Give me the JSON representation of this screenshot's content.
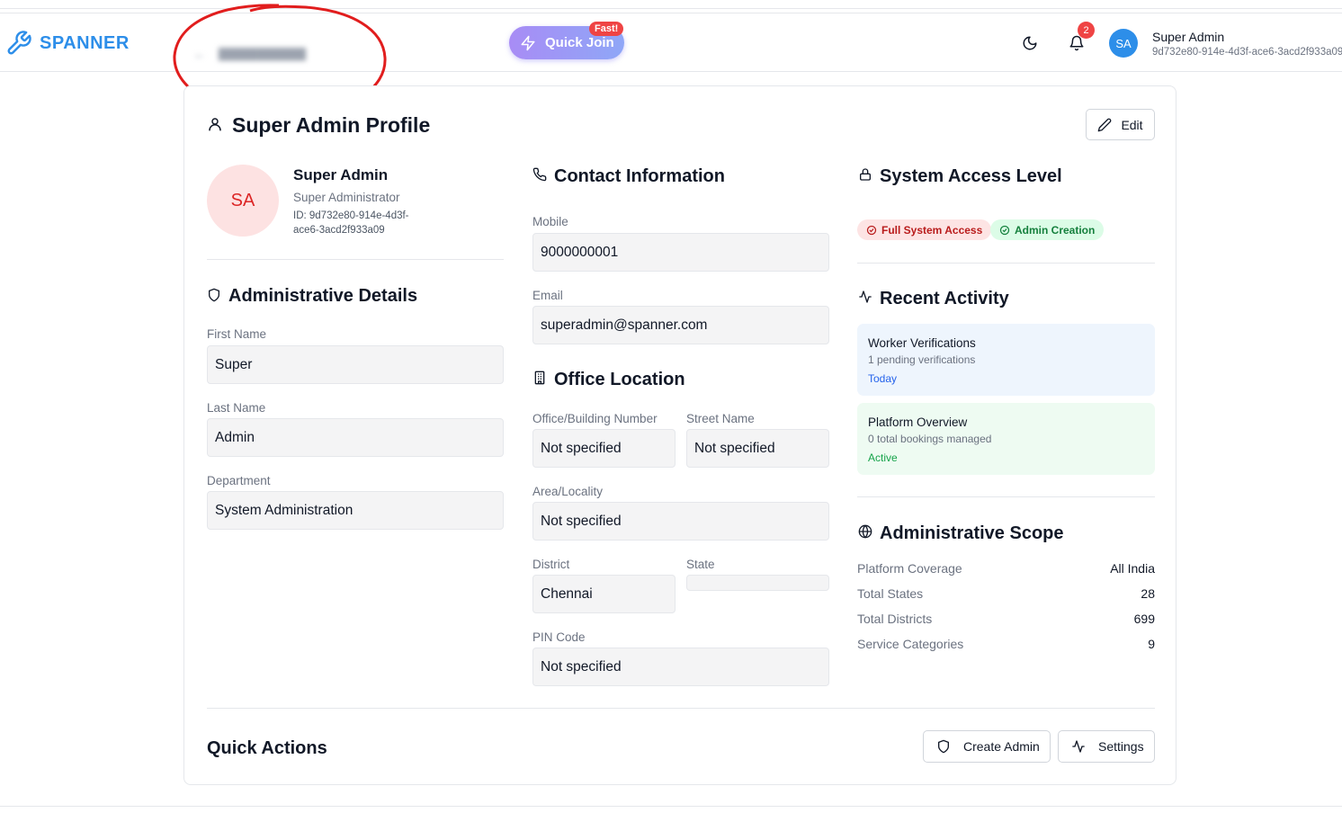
{
  "header": {
    "brand": "SPANNER",
    "quick_join": "Quick Join",
    "fast_badge": "Fast!",
    "notification_count": "2",
    "avatar_initials": "SA",
    "user_name": "Super Admin",
    "user_id": "9d732e80-914e-4d3f-ace6-3acd2f933a09"
  },
  "profile": {
    "title": "Super Admin Profile",
    "edit_label": "Edit",
    "avatar_initials": "SA",
    "name": "Super Admin",
    "role": "Super Administrator",
    "id_line1": "ID: 9d732e80-914e-4d3f-",
    "id_line2": "ace6-3acd2f933a09"
  },
  "admin_details": {
    "title": "Administrative Details",
    "first_name_label": "First Name",
    "first_name": "Super",
    "last_name_label": "Last Name",
    "last_name": "Admin",
    "department_label": "Department",
    "department": "System Administration"
  },
  "contact": {
    "title": "Contact Information",
    "mobile_label": "Mobile",
    "mobile": "9000000001",
    "email_label": "Email",
    "email": "superadmin@spanner.com"
  },
  "office": {
    "title": "Office Location",
    "building_label": "Office/Building Number",
    "building": "Not specified",
    "street_label": "Street Name",
    "street": "Not specified",
    "area_label": "Area/Locality",
    "area": "Not specified",
    "district_label": "District",
    "district": "Chennai",
    "state_label": "State",
    "state": "",
    "pin_label": "PIN Code",
    "pin": "Not specified"
  },
  "access": {
    "title": "System Access Level",
    "badges": [
      "Full System Access",
      "Admin Creation"
    ]
  },
  "activity": {
    "title": "Recent Activity",
    "items": [
      {
        "title": "Worker Verifications",
        "subtitle": "1 pending verifications",
        "tag": "Today"
      },
      {
        "title": "Platform Overview",
        "subtitle": "0 total bookings managed",
        "tag": "Active"
      }
    ]
  },
  "scope": {
    "title": "Administrative Scope",
    "rows": [
      {
        "key": "Platform Coverage",
        "value": "All India"
      },
      {
        "key": "Total States",
        "value": "28"
      },
      {
        "key": "Total Districts",
        "value": "699"
      },
      {
        "key": "Service Categories",
        "value": "9"
      }
    ]
  },
  "quick_actions": {
    "title": "Quick Actions",
    "create_admin": "Create Admin",
    "settings": "Settings"
  },
  "colors": {
    "brand": "#2d8ee9",
    "danger": "#ef4444",
    "activity_blue_bg": "#eef5fd",
    "activity_green_bg": "#eefbf2",
    "annotation_red": "#e11d1d"
  },
  "icons": {
    "brand": "wrench-icon",
    "quick_join": "lightning-icon",
    "theme": "moon-icon",
    "notifications": "bell-icon"
  }
}
